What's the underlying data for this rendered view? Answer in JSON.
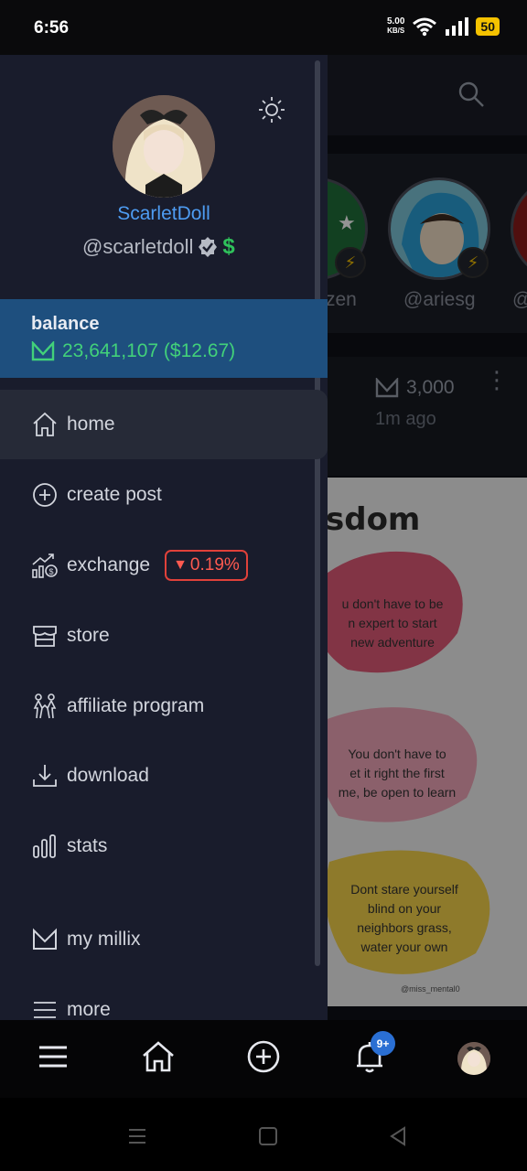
{
  "status_bar": {
    "time": "6:56",
    "speed_value": "5.00",
    "speed_unit": "KB/S",
    "battery": "50"
  },
  "feed": {
    "stories": [
      {
        "name": "zen"
      },
      {
        "name": "@ariesg"
      },
      {
        "name": "@"
      }
    ],
    "post": {
      "amount": "3,000",
      "time": "1m ago",
      "image_heading": "sdom",
      "image_quotes": [
        "u don't have to be\nn expert to start\nnew adventure",
        "You don't have to\net it right the first\nme, be open to learn",
        "Dont stare yourself\nblind on your\nneighbors grass,\nwater your own"
      ],
      "image_credit": "@miss_mental0"
    }
  },
  "drawer": {
    "username": "ScarletDoll",
    "handle": "@scarletdoll",
    "balance_title": "balance",
    "balance_value": "23,641,107 ($12.67)",
    "menu": [
      {
        "label": "home",
        "icon": "home-icon"
      },
      {
        "label": "create post",
        "icon": "plus-circle-icon"
      },
      {
        "label": "exchange",
        "icon": "exchange-icon",
        "badge": "0.19%"
      },
      {
        "label": "store",
        "icon": "store-icon"
      },
      {
        "label": "affiliate program",
        "icon": "affiliate-icon"
      },
      {
        "label": "download",
        "icon": "download-icon"
      },
      {
        "label": "stats",
        "icon": "stats-icon"
      },
      {
        "label": "my millix",
        "icon": "millix-icon"
      },
      {
        "label": "more",
        "icon": "menu-icon"
      }
    ]
  },
  "bottom_nav": {
    "notification_badge": "9+"
  },
  "colors": {
    "drawer_bg": "#191c2c",
    "balance_bg": "#1e4f7e",
    "accent_blue": "#4e9cf2",
    "balance_green": "#42d17a",
    "negative_red": "#ff5a50"
  }
}
